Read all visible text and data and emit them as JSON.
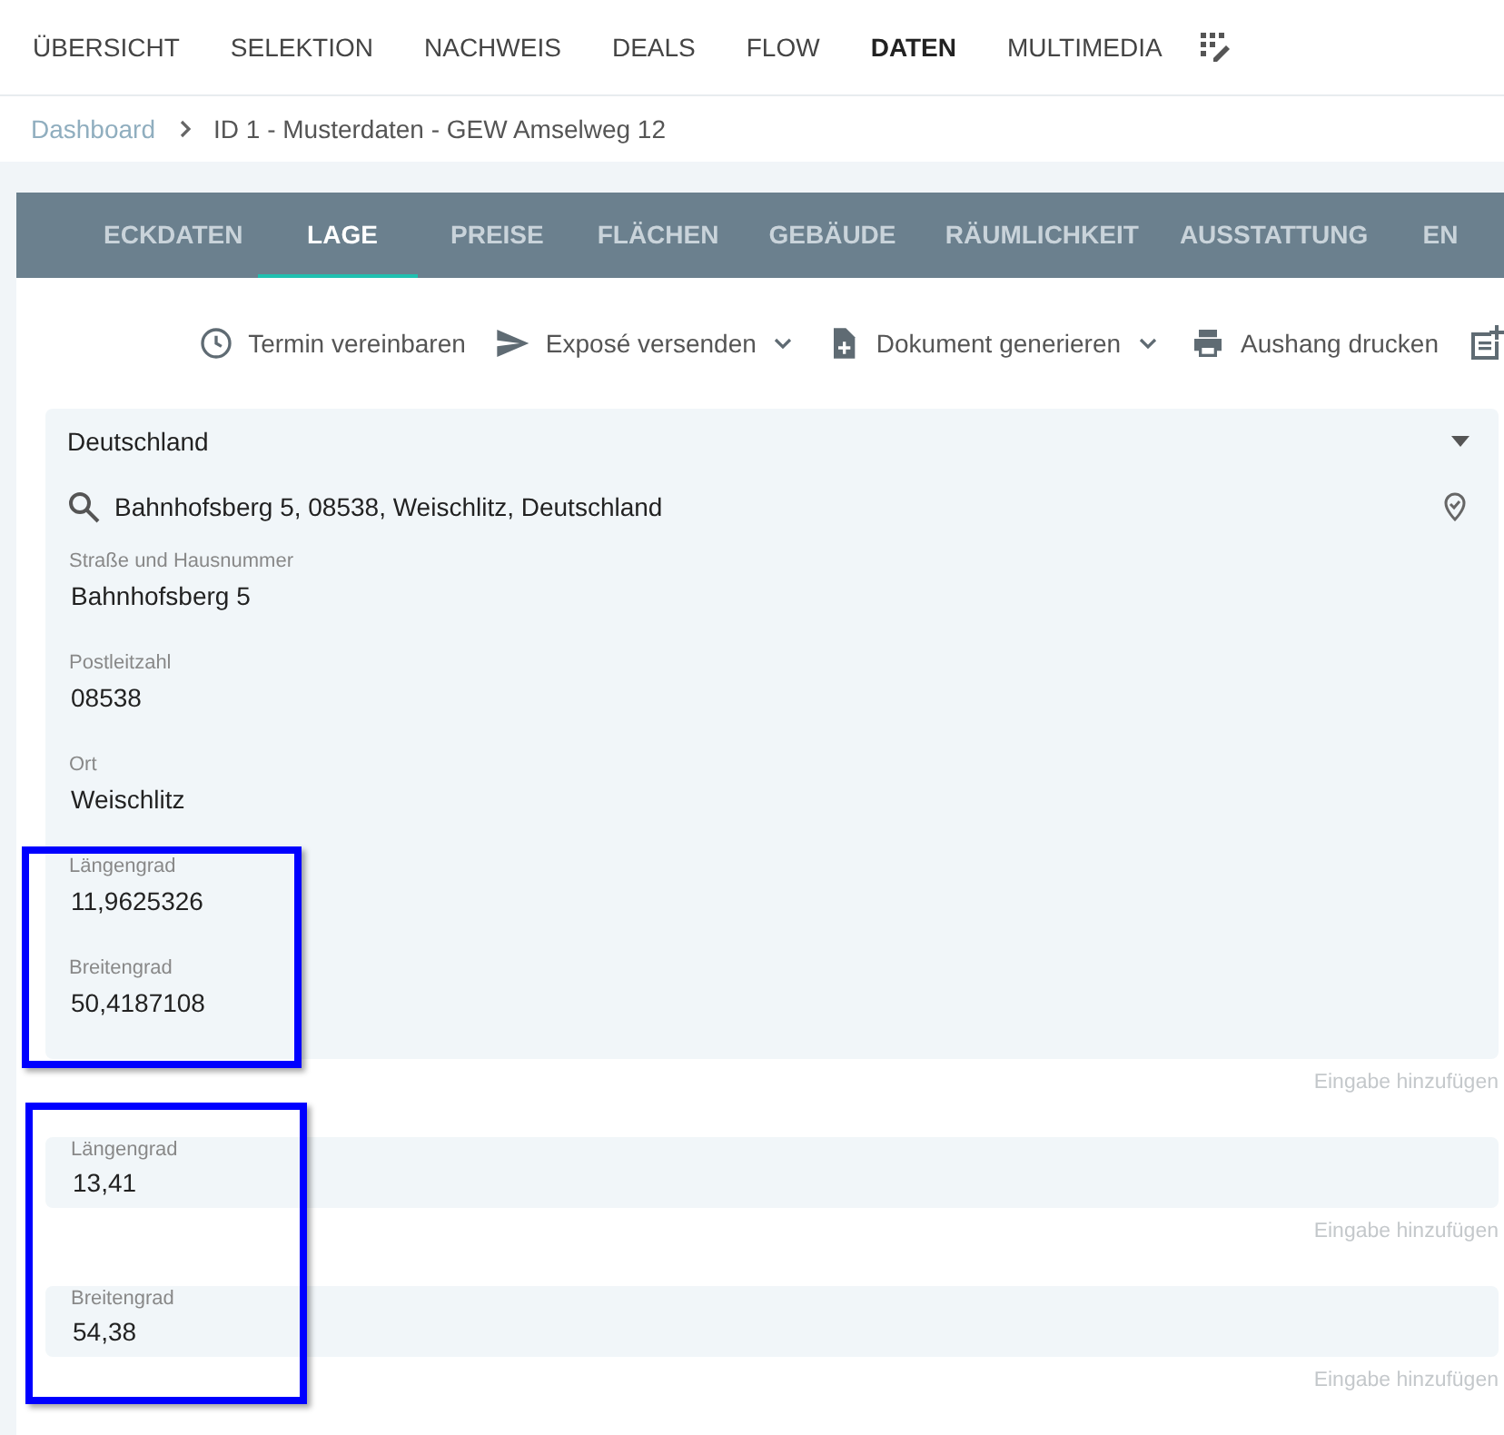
{
  "nav": [
    {
      "label": "ÜBERSICHT",
      "selected": false
    },
    {
      "label": "SELEKTION",
      "selected": false
    },
    {
      "label": "NACHWEIS",
      "selected": false
    },
    {
      "label": "DEALS",
      "selected": false
    },
    {
      "label": "FLOW",
      "selected": false
    },
    {
      "label": "DATEN",
      "selected": true
    },
    {
      "label": "MULTIMEDIA",
      "selected": false
    }
  ],
  "breadcrumb": [
    {
      "label": "Dashboard"
    },
    {
      "label": "ID 1 - Musterdaten - GEW Amselweg 12"
    }
  ],
  "tabs": [
    {
      "label": "ECKDATEN",
      "selected": false
    },
    {
      "label": "LAGE",
      "selected": true
    },
    {
      "label": "PREISE",
      "selected": false
    },
    {
      "label": "FLÄCHEN",
      "selected": false
    },
    {
      "label": "GEBÄUDE",
      "selected": false
    },
    {
      "label": "RÄUMLICHKEIT",
      "selected": false
    },
    {
      "label": "AUSSTATTUNG",
      "selected": false
    },
    {
      "label": "EN",
      "selected": false
    }
  ],
  "actions": [
    {
      "label": "Termin vereinbaren",
      "has_menu": false
    },
    {
      "label": "Exposé versenden",
      "has_menu": true
    },
    {
      "label": "Dokument generieren",
      "has_menu": true
    },
    {
      "label": "Aushang drucken",
      "has_menu": false
    }
  ],
  "location": {
    "country": "Deutschland",
    "address": "Bahnhofsberg 5, 08538, Weischlitz, Deutschland",
    "fields": [
      {
        "label": "Straße und Hausnummer",
        "value": "Bahnhofsberg 5"
      },
      {
        "label": "Postleitzahl",
        "value": "08538"
      },
      {
        "label": "Ort",
        "value": "Weischlitz"
      },
      {
        "label": "Längengrad",
        "value": "11,9625326"
      },
      {
        "label": "Breitengrad",
        "value": "50,4187108"
      }
    ],
    "add_label": "Eingabe hinzufügen"
  },
  "entries": [
    {
      "label": "Längengrad",
      "value": "13,41",
      "add_label": "Eingabe hinzufügen"
    },
    {
      "label": "Breitengrad",
      "value": "54,38",
      "add_label": "Eingabe hinzufügen"
    }
  ]
}
